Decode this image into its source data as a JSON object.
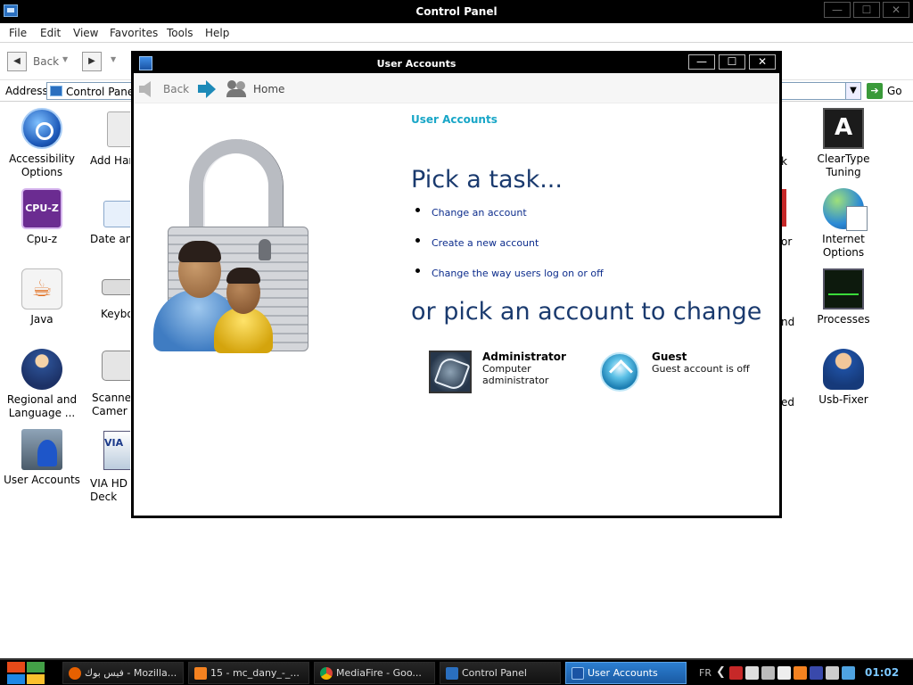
{
  "control_panel": {
    "title": "Control Panel",
    "window_buttons": {
      "minimize": "—",
      "maximize": "☐",
      "close": "✕"
    },
    "menu": [
      "File",
      "Edit",
      "View",
      "Favorites",
      "Tools",
      "Help"
    ],
    "toolbar": {
      "back": "Back",
      "back_arrow": "◀",
      "forward_arrow": "▶",
      "caret": "▼"
    },
    "address": {
      "label": "Address",
      "value": "Control Panel",
      "dropdown_arrow": "▼",
      "go_arrow": "➔",
      "go": "Go"
    },
    "items_left": [
      {
        "label": "Accessibility Options",
        "icon": "accessibility-icon"
      },
      {
        "label": "Cpu-z",
        "icon": "cpu-z-icon",
        "glyph": "CPU-Z"
      },
      {
        "label": "Java",
        "icon": "java-icon",
        "glyph": "☕"
      },
      {
        "label": "Regional and Language ...",
        "icon": "regional-language-icon"
      },
      {
        "label": "User Accounts",
        "icon": "user-accounts-icon"
      }
    ],
    "items_col2": [
      {
        "label": "Add Hard",
        "icon": "add-hardware-icon"
      },
      {
        "label": "Date and",
        "icon": "date-time-icon"
      },
      {
        "label": "Keyboa",
        "icon": "keyboard-icon"
      },
      {
        "label": "Scanners Camer",
        "icon": "scanner-camera-icon"
      },
      {
        "label": "VIA HD A Deck",
        "icon": "via-hd-audio-icon",
        "glyph": "VIA"
      }
    ],
    "items_right": [
      {
        "label": "ClearType Tuning",
        "icon": "cleartype-icon",
        "glyph": "A"
      },
      {
        "label": "Internet Options",
        "icon": "internet-options-icon"
      },
      {
        "label": "Processes",
        "icon": "processes-icon"
      },
      {
        "label": "Usb-Fixer",
        "icon": "usb-fixer-icon"
      }
    ],
    "hidden_fragments": [
      "k",
      "or",
      "nd",
      "ed"
    ]
  },
  "dialog": {
    "title": "User Accounts",
    "buttons": {
      "minimize": "—",
      "maximize": "☐",
      "close": "✕"
    },
    "nav": {
      "back": "Back",
      "home": "Home"
    },
    "breadcrumb": "User Accounts",
    "heading_tasks": "Pick a task...",
    "tasks": [
      "Change an account",
      "Create a new account",
      "Change the way users log on or off"
    ],
    "heading_accounts": "or pick an account to change",
    "accounts": [
      {
        "name": "Administrator",
        "description": "Computer administrator"
      },
      {
        "name": "Guest",
        "description": "Guest account is off"
      }
    ]
  },
  "taskbar": {
    "buttons": [
      {
        "label": "فيس بوك - Mozilla...",
        "icon": "firefox-icon",
        "color": "#e66000"
      },
      {
        "label": "15 - mc_dany_-_...",
        "icon": "vlc-icon",
        "color": "#f58220"
      },
      {
        "label": "MediaFire - Goo...",
        "icon": "chrome-icon",
        "color": "#db4437"
      },
      {
        "label": "Control Panel",
        "icon": "control-panel-icon",
        "color": "#2a6fbf"
      },
      {
        "label": "User Accounts",
        "icon": "user-accounts-icon",
        "color": "#1a54a4",
        "active": true
      }
    ],
    "language": "FR",
    "tray_chevron": "❮",
    "clock": "01:02"
  }
}
